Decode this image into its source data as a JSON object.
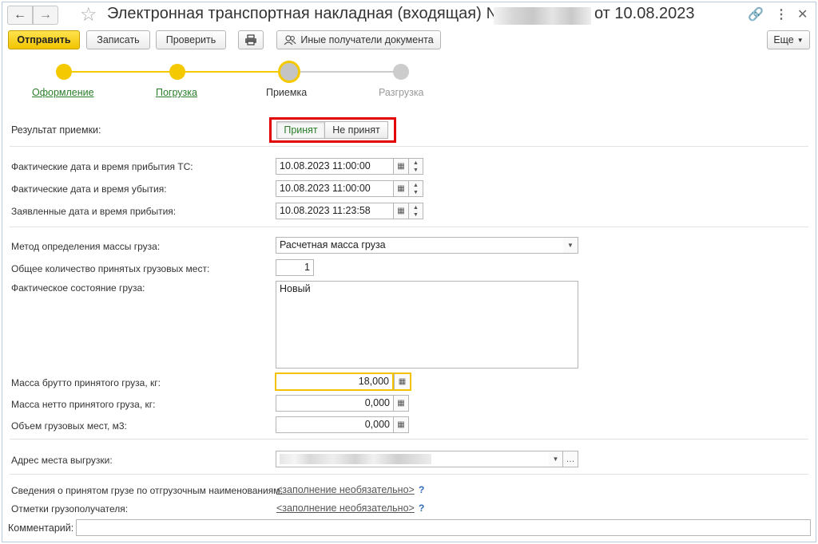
{
  "window": {
    "title_prefix": "Электронная транспортная накладная (входящая) №",
    "title_suffix": "от 10.08.2023"
  },
  "toolbar": {
    "send": "Отправить",
    "save": "Записать",
    "check": "Проверить",
    "print_icon": "printer-icon",
    "other_recipients": "Иные получатели документа",
    "more": "Еще"
  },
  "stepper": {
    "steps": [
      {
        "label": "Оформление",
        "state": "done"
      },
      {
        "label": "Погрузка",
        "state": "done"
      },
      {
        "label": "Приемка",
        "state": "current"
      },
      {
        "label": "Разгрузка",
        "state": "pending"
      }
    ],
    "colors": {
      "done": "#f5c900",
      "pending": "#cccccc",
      "highlight": "#e30000"
    }
  },
  "form": {
    "result_label": "Результат приемки:",
    "result_options": [
      "Принят",
      "Не принят"
    ],
    "result_selected": "Принят",
    "arrival_actual_label": "Фактические дата и время прибытия ТС:",
    "arrival_actual_value": "10.08.2023 11:00:00",
    "departure_actual_label": "Фактические дата и время убытия:",
    "departure_actual_value": "10.08.2023 11:00:00",
    "arrival_declared_label": "Заявленные дата и время прибытия:",
    "arrival_declared_value": "10.08.2023 11:23:58",
    "mass_method_label": "Метод определения массы груза:",
    "mass_method_value": "Расчетная масса груза",
    "places_label": "Общее количество принятых грузовых мест:",
    "places_value": "1",
    "state_label": "Фактическое состояние груза:",
    "state_value": "Новый",
    "gross_label": "Масса брутто принятого груза, кг:",
    "gross_value": "18,000",
    "net_label": "Масса нетто принятого груза, кг:",
    "net_value": "0,000",
    "volume_label": "Объем грузовых мест, м3:",
    "volume_value": "0,000",
    "address_label": "Адрес места выгрузки:",
    "cargo_info_label": "Сведения о принятом грузе по отгрузочным наименованиям:",
    "cargo_info_link": "<заполнение необязательно>",
    "consignee_marks_label": "Отметки грузополучателя:",
    "consignee_marks_link": "<заполнение необязательно>",
    "help_mark": "?",
    "comment_label": "Комментарий:",
    "comment_value": ""
  }
}
